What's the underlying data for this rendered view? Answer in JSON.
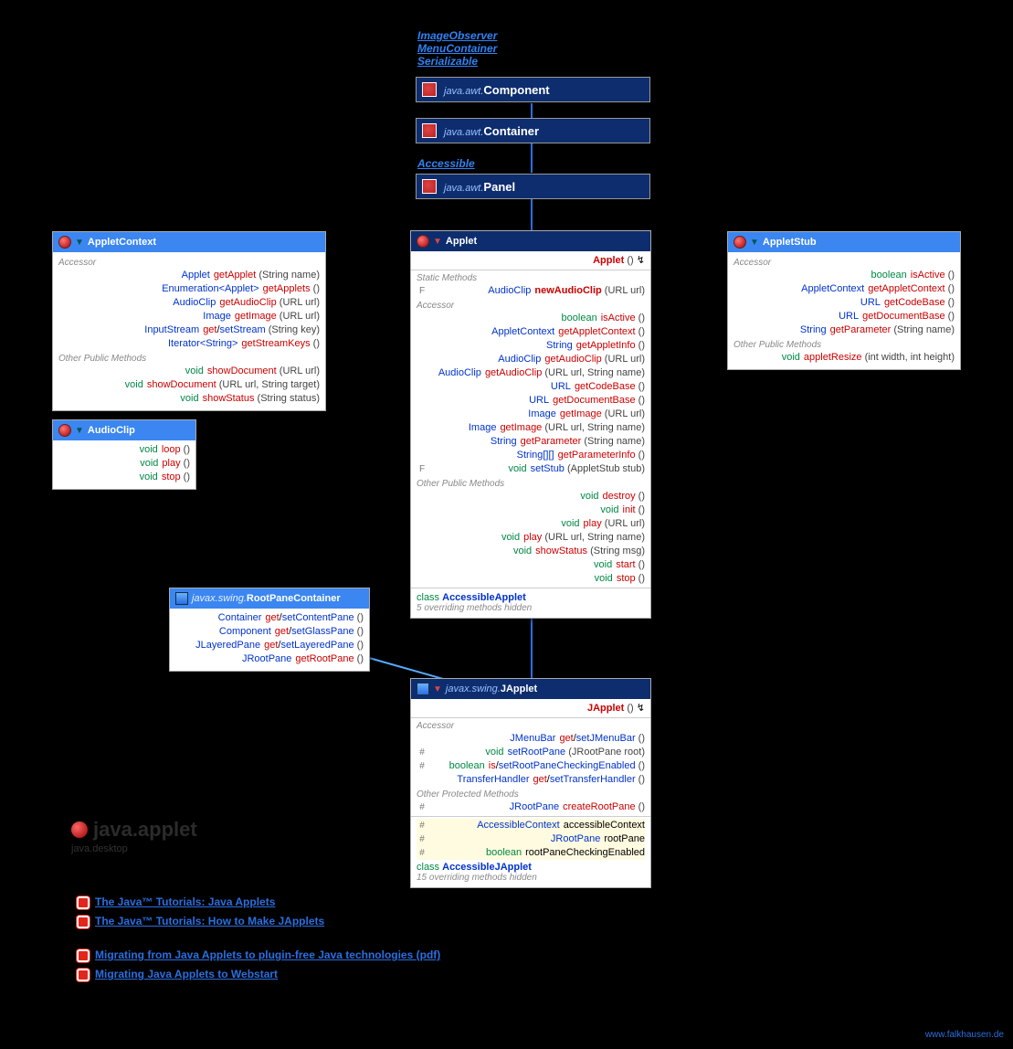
{
  "interfaces_top": [
    "ImageObserver",
    "MenuContainer",
    "Serializable"
  ],
  "accessible_label": "Accessible",
  "hdr1": {
    "pkg": "java.awt.",
    "cls": "Component"
  },
  "hdr2": {
    "pkg": "java.awt.",
    "cls": "Container"
  },
  "hdr3": {
    "pkg": "java.awt.",
    "cls": "Panel"
  },
  "appletcontext": {
    "title": "AppletContext",
    "sec1": "Accessor",
    "sec2": "Other Public Methods",
    "r1": {
      "ret": "Applet",
      "m": "getApplet",
      "a": "(String name)"
    },
    "r2": {
      "ret": "Enumeration<Applet>",
      "m": "getApplets",
      "a": "()"
    },
    "r3": {
      "ret": "AudioClip",
      "m": "getAudioClip",
      "a": "(URL url)"
    },
    "r4": {
      "ret": "Image",
      "m": "getImage",
      "a": "(URL url)"
    },
    "r5": {
      "ret": "InputStream",
      "m": "get",
      "s": "setStream",
      "a": "(String key)"
    },
    "r6": {
      "ret": "Iterator<String>",
      "m": "getStreamKeys",
      "a": "()"
    },
    "r7": {
      "ret": "void",
      "m": "showDocument",
      "a": "(URL url)"
    },
    "r8": {
      "ret": "void",
      "m": "showDocument",
      "a": "(URL url, String target)"
    },
    "r9": {
      "ret": "void",
      "m": "showStatus",
      "a": "(String status)"
    }
  },
  "audioclip": {
    "title": "AudioClip",
    "r1": {
      "ret": "void",
      "m": "loop",
      "a": "()"
    },
    "r2": {
      "ret": "void",
      "m": "play",
      "a": "()"
    },
    "r3": {
      "ret": "void",
      "m": "stop",
      "a": "()"
    }
  },
  "appletstub": {
    "title": "AppletStub",
    "sec1": "Accessor",
    "sec2": "Other Public Methods",
    "r1": {
      "ret": "boolean",
      "m": "isActive",
      "a": "()"
    },
    "r2": {
      "ret": "AppletContext",
      "m": "getAppletContext",
      "a": "()"
    },
    "r3": {
      "ret": "URL",
      "m": "getCodeBase",
      "a": "()"
    },
    "r4": {
      "ret": "URL",
      "m": "getDocumentBase",
      "a": "()"
    },
    "r5": {
      "ret": "String",
      "m": "getParameter",
      "a": "(String name)"
    },
    "r6": {
      "ret": "void",
      "m": "appletResize",
      "a": "(int width, int height)"
    }
  },
  "rootpane": {
    "pkg": "javax.swing.",
    "title": "RootPaneContainer",
    "r1": {
      "ret": "Container",
      "m": "get",
      "s": "setContentPane",
      "a": "()"
    },
    "r2": {
      "ret": "Component",
      "m": "get",
      "s": "setGlassPane",
      "a": "()"
    },
    "r3": {
      "ret": "JLayeredPane",
      "m": "get",
      "s": "setLayeredPane",
      "a": "()"
    },
    "r4": {
      "ret": "JRootPane",
      "m": "getRootPane",
      "a": "()"
    }
  },
  "applet": {
    "title": "Applet",
    "ctor": {
      "m": "Applet",
      "a": "()",
      "throws": "↯"
    },
    "sec1": "Static Methods",
    "sec2": "Accessor",
    "sec3": "Other Public Methods",
    "s1": {
      "mod": "F",
      "ret": "AudioClip",
      "m": "newAudioClip",
      "a": "(URL url)"
    },
    "a1": {
      "ret": "boolean",
      "m": "isActive",
      "a": "()"
    },
    "a2": {
      "ret": "AppletContext",
      "m": "getAppletContext",
      "a": "()"
    },
    "a3": {
      "ret": "String",
      "m": "getAppletInfo",
      "a": "()"
    },
    "a4": {
      "ret": "AudioClip",
      "m": "getAudioClip",
      "a": "(URL url)"
    },
    "a5": {
      "ret": "AudioClip",
      "m": "getAudioClip",
      "a": "(URL url, String name)"
    },
    "a6": {
      "ret": "URL",
      "m": "getCodeBase",
      "a": "()"
    },
    "a7": {
      "ret": "URL",
      "m": "getDocumentBase",
      "a": "()"
    },
    "a8": {
      "ret": "Image",
      "m": "getImage",
      "a": "(URL url)"
    },
    "a9": {
      "ret": "Image",
      "m": "getImage",
      "a": "(URL url, String name)"
    },
    "a10": {
      "ret": "String",
      "m": "getParameter",
      "a": "(String name)"
    },
    "a11": {
      "ret": "String[][]",
      "m": "getParameterInfo",
      "a": "()"
    },
    "a12": {
      "mod": "F",
      "ret": "void",
      "m": "setStub",
      "a": "(AppletStub stub)"
    },
    "o1": {
      "ret": "void",
      "m": "destroy",
      "a": "()"
    },
    "o2": {
      "ret": "void",
      "m": "init",
      "a": "()"
    },
    "o3": {
      "ret": "void",
      "m": "play",
      "a": "(URL url)"
    },
    "o4": {
      "ret": "void",
      "m": "play",
      "a": "(URL url, String name)"
    },
    "o5": {
      "ret": "void",
      "m": "showStatus",
      "a": "(String msg)"
    },
    "o6": {
      "ret": "void",
      "m": "start",
      "a": "()"
    },
    "o7": {
      "ret": "void",
      "m": "stop",
      "a": "()"
    },
    "inner": "AccessibleApplet",
    "hidden": "5 overriding methods hidden"
  },
  "japplet": {
    "pkg": "javax.swing.",
    "title": "JApplet",
    "ctor": {
      "m": "JApplet",
      "a": "()",
      "throws": "↯"
    },
    "sec1": "Accessor",
    "sec2": "Other Protected Methods",
    "a1": {
      "ret": "JMenuBar",
      "m": "get",
      "s": "setJMenuBar",
      "a": "()"
    },
    "a2": {
      "mod": "#",
      "ret": "void",
      "m": "setRootPane",
      "a": "(JRootPane root)"
    },
    "a3": {
      "mod": "#",
      "ret": "boolean",
      "m": "is",
      "s": "setRootPaneCheckingEnabled",
      "a": "()"
    },
    "a4": {
      "ret": "TransferHandler",
      "m": "get",
      "s": "setTransferHandler",
      "a": "()"
    },
    "p1": {
      "mod": "#",
      "ret": "JRootPane",
      "m": "createRootPane",
      "a": "()"
    },
    "f1": {
      "mod": "#",
      "ret": "AccessibleContext",
      "n": "accessibleContext"
    },
    "f2": {
      "mod": "#",
      "ret": "JRootPane",
      "n": "rootPane"
    },
    "f3": {
      "mod": "#",
      "ret": "boolean",
      "n": "rootPaneCheckingEnabled"
    },
    "inner": "AccessibleJApplet",
    "hidden": "15 overriding methods hidden"
  },
  "package": {
    "name": "java.applet",
    "module": "java.desktop"
  },
  "links": {
    "l1": "The Java™ Tutorials: Java Applets",
    "l2": "The Java™ Tutorials: How to Make JApplets",
    "l3": "Migrating from Java Applets to plugin-free Java technologies (pdf)",
    "l4": "Migrating Java Applets to Webstart"
  },
  "watermark": "www.falkhausen.de",
  "cls_label": "class"
}
